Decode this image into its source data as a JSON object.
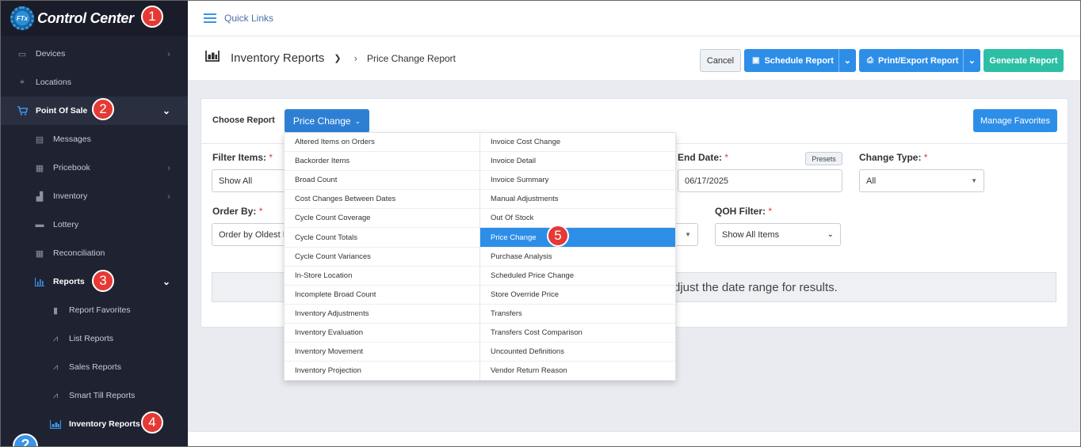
{
  "app": {
    "brand_logo_text": "FTx",
    "brand_title": "Control Center"
  },
  "topbar": {
    "quick_links": "Quick Links"
  },
  "sidebar": {
    "devices": "Devices",
    "locations": "Locations",
    "point_of_sale": "Point Of Sale",
    "messages": "Messages",
    "pricebook": "Pricebook",
    "inventory": "Inventory",
    "lottery": "Lottery",
    "reconciliation": "Reconciliation",
    "reports": "Reports",
    "report_favorites": "Report Favorites",
    "list_reports": "List Reports",
    "sales_reports": "Sales Reports",
    "smart_till_reports": "Smart Till Reports",
    "inventory_reports": "Inventory Reports"
  },
  "header": {
    "title": "Inventory Reports",
    "breadcrumb": "Price Change Report",
    "cancel": "Cancel",
    "schedule": "Schedule Report",
    "print_export": "Print/Export Report",
    "generate": "Generate Report"
  },
  "card": {
    "choose_report": "Choose Report",
    "selected_report": "Price Change",
    "manage_favorites": "Manage Favorites",
    "filter_items_label": "Filter Items:",
    "filter_items_value": "Show All",
    "end_date_label": "End Date:",
    "end_date_value": "06/17/2025",
    "presets": "Presets",
    "change_type_label": "Change Type:",
    "change_type_value": "All",
    "order_by_label": "Order By:",
    "order_by_value": "Order by Oldest F",
    "qoh_filter_label": "QOH Filter:",
    "qoh_filter_value": "Show All Items",
    "required_mark": "*",
    "info_message": "djust the date range for results."
  },
  "dropdown": {
    "left": [
      "Altered Items on Orders",
      "Backorder Items",
      "Broad Count",
      "Cost Changes Between Dates",
      "Cycle Count Coverage",
      "Cycle Count Totals",
      "Cycle Count Variances",
      "In-Store Location",
      "Incomplete Broad Count",
      "Inventory Adjustments",
      "Inventory Evaluation",
      "Inventory Movement",
      "Inventory Projection"
    ],
    "right": [
      "Invoice Cost Change",
      "Invoice Detail",
      "Invoice Summary",
      "Manual Adjustments",
      "Out Of Stock",
      "Price Change",
      "Purchase Analysis",
      "Scheduled Price Change",
      "Store Override Price",
      "Transfers",
      "Transfers Cost Comparison",
      "Uncounted Definitions",
      "Vendor Return Reason"
    ]
  },
  "callouts": {
    "b1": "1",
    "b2": "2",
    "b3": "3",
    "b4": "4",
    "b5": "5"
  },
  "help": {
    "label": "?"
  },
  "colors": {
    "accent": "#2d8ee8",
    "sidebar_bg": "#1f2331",
    "generate": "#2cbfa5",
    "callout": "#e53935"
  }
}
